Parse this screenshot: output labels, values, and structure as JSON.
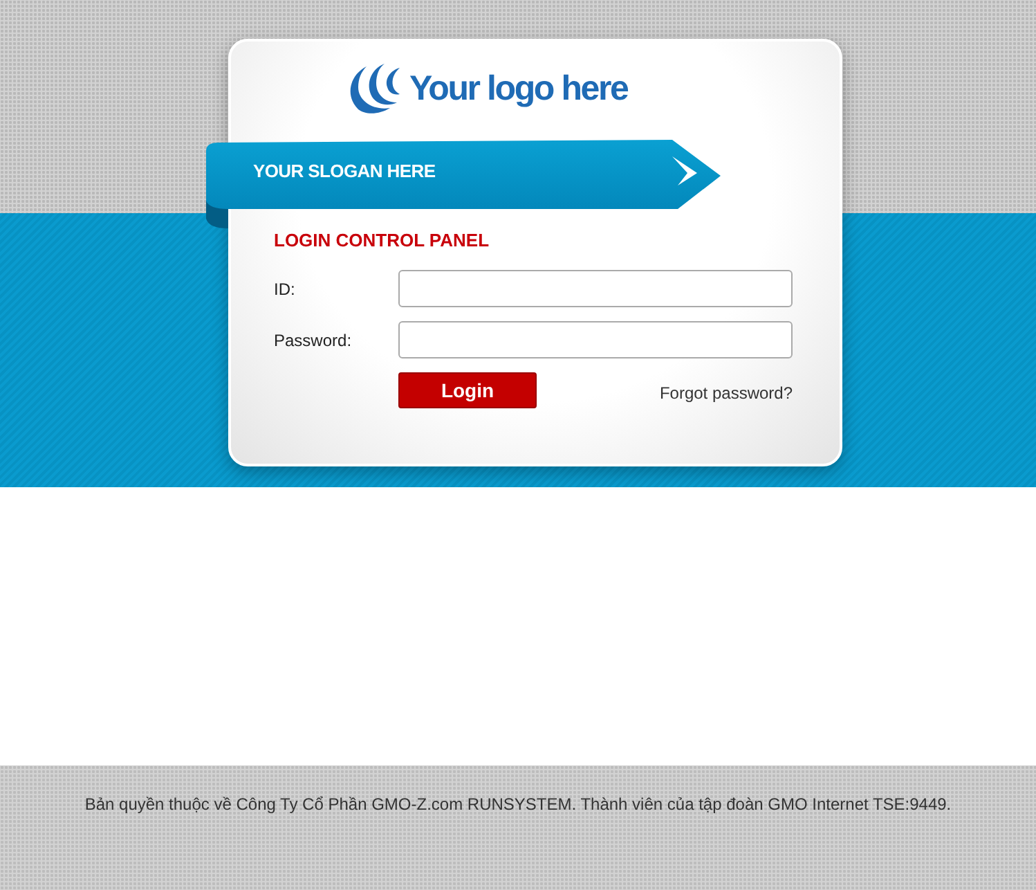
{
  "logo": {
    "text": "Your logo here"
  },
  "slogan": "YOUR SLOGAN HERE",
  "panel": {
    "title": "LOGIN CONTROL PANEL",
    "fields": [
      {
        "label": "ID:"
      },
      {
        "label": "Password:"
      }
    ],
    "submit": "Login",
    "forgot_link": "Forgot password?"
  },
  "footer": "Bản quyền thuộc về Công Ty Cổ Phần GMO-Z.com RUNSYSTEM. Thành viên của tập đoàn GMO Internet TSE:9449."
}
